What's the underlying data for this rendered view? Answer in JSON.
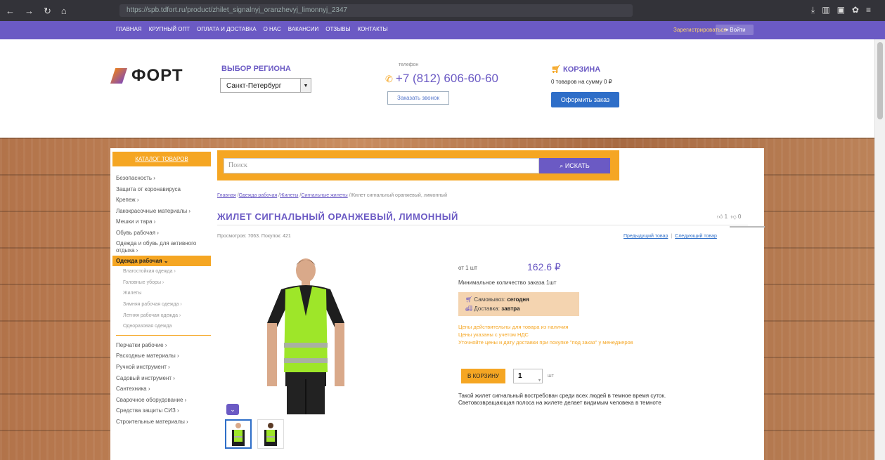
{
  "browser": {
    "url": "https://spb.tdfort.ru/product/zhilet_signalnyj_oranzhevyj_limonnyj_2347",
    "nav_icons": [
      "back-icon",
      "forward-icon",
      "reload-icon",
      "home-icon"
    ]
  },
  "topnav": {
    "links": [
      "ГЛАВНАЯ",
      "КРУПНЫЙ ОПТ",
      "ОПЛАТА И ДОСТАВКА",
      "О НАС",
      "ВАКАНСИИ",
      "ОТЗЫВЫ",
      "КОНТАКТЫ"
    ],
    "register": "Зарегистрироваться",
    "login": "Войти"
  },
  "header": {
    "logo": "ФОРТ",
    "region_title": "ВЫБОР РЕГИОНА",
    "region_value": "Санкт-Петербург",
    "phone_label": "телефон",
    "phone": "+7 (812) 606-60-60",
    "callback": "Заказать звонок",
    "cart_title": "КОРЗИНА",
    "cart_sum": "0 товаров на сумму 0 ₽",
    "order_btn": "Оформить заказ"
  },
  "sidebar": {
    "catalog_btn": "КАТАЛОГ ТОВАРОВ",
    "items_top": [
      "Безопасность",
      "Защита от коронавируса",
      "Крепеж",
      "Лакокрасочные материалы",
      "Мешки и тара",
      "Обувь рабочая"
    ],
    "item_two_line": "Одежда и обувь для активного отдыха",
    "active": "Одежда рабочая",
    "subitems": [
      "Влагостойкая одежда",
      "Головные уборы",
      "Жилеты",
      "Зимняя рабочая одежда",
      "Летняя рабочая одежда",
      "Одноразовая одежда"
    ],
    "items_bottom": [
      "Перчатки рабочие",
      "Расходные материалы",
      "Ручной инструмент",
      "Садовый инструмент",
      "Сантехника",
      "Сварочное оборудование",
      "Средства защиты СИЗ",
      "Строительные материалы"
    ]
  },
  "search": {
    "placeholder": "Поиск",
    "button": "ИСКАТЬ"
  },
  "breadcrumb": {
    "links": [
      "Главная",
      "Одежда рабочая",
      "Жилеты",
      "Сигнальные жилеты"
    ],
    "current": "Жилет сигнальный оранжевый, лимонный"
  },
  "product": {
    "title": "ЖИЛЕТ СИГНАЛЬНЫЙ ОРАНЖЕВЫЙ, ЛИМОННЫЙ",
    "likes": "1",
    "dislikes": "0",
    "stats": "Просмотров: 7063. Покупок: 421",
    "prev": "Предыдущий товар",
    "next": "Следующий товар",
    "from_label": "от 1 шт",
    "price": "162.6 ₽",
    "min_qty": "Минимальное количество заказа 1шт",
    "pickup_label": "Самовывоз:",
    "pickup_value": "сегодня",
    "delivery_label": "Доставка:",
    "delivery_value": "завтра",
    "notes": [
      "Цены действительны для товара из наличия",
      "Цены указаны с учетом НДС",
      "Уточняйте цены и дату доставки при покупке \"под заказ\" у менеджеров"
    ],
    "to_cart": "В КОРЗИНУ",
    "qty": "1",
    "unit": "шт",
    "description": "Такой жилет сигнальный востребован среди всех людей в темное время суток. Световозвращающая полоса на жилете делает видимым человека в темноте"
  },
  "colors": {
    "brand_purple": "#6b5ac4",
    "accent_orange": "#f5a623",
    "button_blue": "#2e6ec8"
  }
}
